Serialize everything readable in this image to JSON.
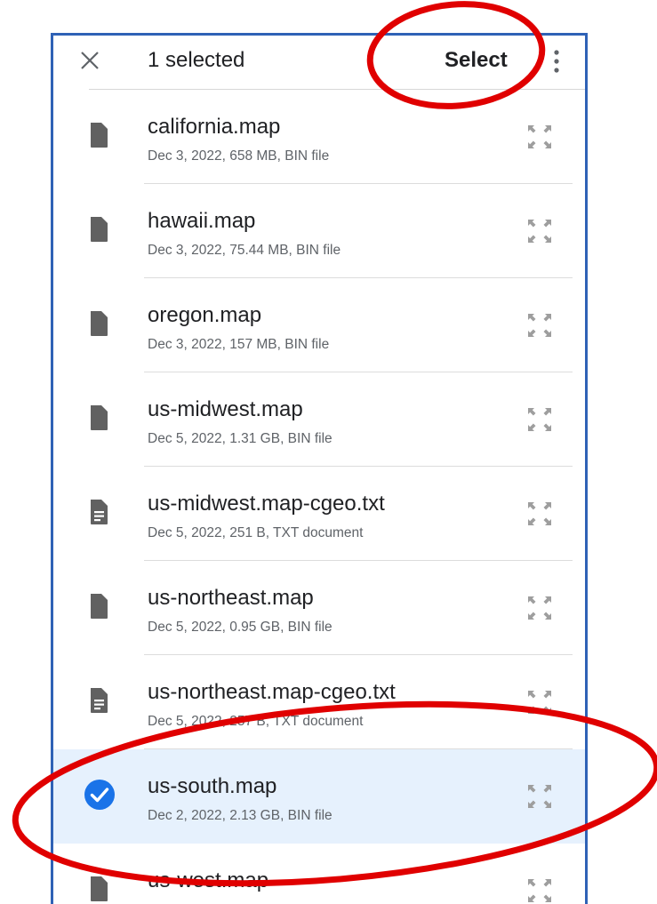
{
  "header": {
    "close_icon": "close-icon",
    "title": "1 selected",
    "select_label": "Select",
    "more_icon": "more-vert-icon"
  },
  "files": [
    {
      "name": "california.map",
      "meta": "Dec 3, 2022, 658 MB, BIN file",
      "icon": "file-icon",
      "selected": false
    },
    {
      "name": "hawaii.map",
      "meta": "Dec 3, 2022, 75.44 MB, BIN file",
      "icon": "file-icon",
      "selected": false
    },
    {
      "name": "oregon.map",
      "meta": "Dec 3, 2022, 157 MB, BIN file",
      "icon": "file-icon",
      "selected": false
    },
    {
      "name": "us-midwest.map",
      "meta": "Dec 5, 2022, 1.31 GB, BIN file",
      "icon": "file-icon",
      "selected": false
    },
    {
      "name": "us-midwest.map-cgeo.txt",
      "meta": "Dec 5, 2022, 251 B, TXT document",
      "icon": "text-file-icon",
      "selected": false
    },
    {
      "name": "us-northeast.map",
      "meta": "Dec 5, 2022, 0.95 GB, BIN file",
      "icon": "file-icon",
      "selected": false
    },
    {
      "name": "us-northeast.map-cgeo.txt",
      "meta": "Dec 5, 2022, 257 B, TXT document",
      "icon": "text-file-icon",
      "selected": false
    },
    {
      "name": "us-south.map",
      "meta": "Dec 2, 2022, 2.13 GB, BIN file",
      "icon": "check-circle-icon",
      "selected": true
    },
    {
      "name": "us-west.map",
      "meta": "",
      "icon": "file-icon",
      "selected": false
    }
  ],
  "colors": {
    "selected_bg": "#e6f1fd",
    "check_blue": "#1a73e8",
    "frame_border": "#2f62b6",
    "annotation_red": "#e00000"
  }
}
